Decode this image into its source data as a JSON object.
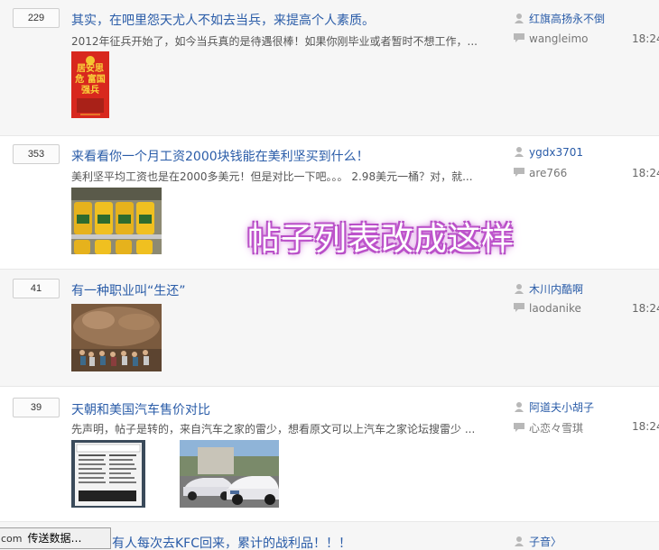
{
  "posts": [
    {
      "count": "229",
      "title": "其实，在吧里怨天尤人不如去当兵，来提高个人素质。",
      "excerpt": "2012年征兵开始了，如今当兵真的是待遇很棒！如果你刚毕业或者暂时不想工作，...",
      "author": "红旗高扬永不倒",
      "last_reply": "wangleimo",
      "time": "18:24",
      "thumb_text": "居安思危 富国强兵"
    },
    {
      "count": "353",
      "title": "来看看你一个月工资2000块钱能在美利坚买到什么！",
      "excerpt": "美利坚平均工资也是在2000多美元！但是对比一下吧。。。 2.98美元一桶？对，就...",
      "author": "ygdx3701",
      "last_reply": "are766",
      "time": "18:24"
    },
    {
      "count": "41",
      "title": "有一种职业叫“生还”",
      "excerpt": "",
      "author": "木川内酷啊",
      "last_reply": "laodanike",
      "time": "18:24"
    },
    {
      "count": "39",
      "title": "天朝和美国汽车售价对比",
      "excerpt": "先声明，帖子是转的，来自汽车之家的雷少，想看原文可以上汽车之家论坛搜雷少 ...",
      "author": "阿道夫小胡子",
      "last_reply": "心恋々雪琪",
      "time": "18:24"
    },
    {
      "count": "",
      "title": "有人每次去KFC回来，累计的战利品！！！",
      "excerpt": "",
      "author": "子音〉",
      "last_reply": "",
      "time": ""
    }
  ],
  "overlay_text": "帖子列表改成这样",
  "status": {
    "prefix": "com",
    "text": "传送数据…"
  },
  "colors": {
    "title": "#2a5ca8",
    "overlay_glow": "#c45ad0",
    "alt_row_bg": "#f6f6f6"
  },
  "icons": {
    "author": "user-icon",
    "reply": "comment-icon"
  }
}
